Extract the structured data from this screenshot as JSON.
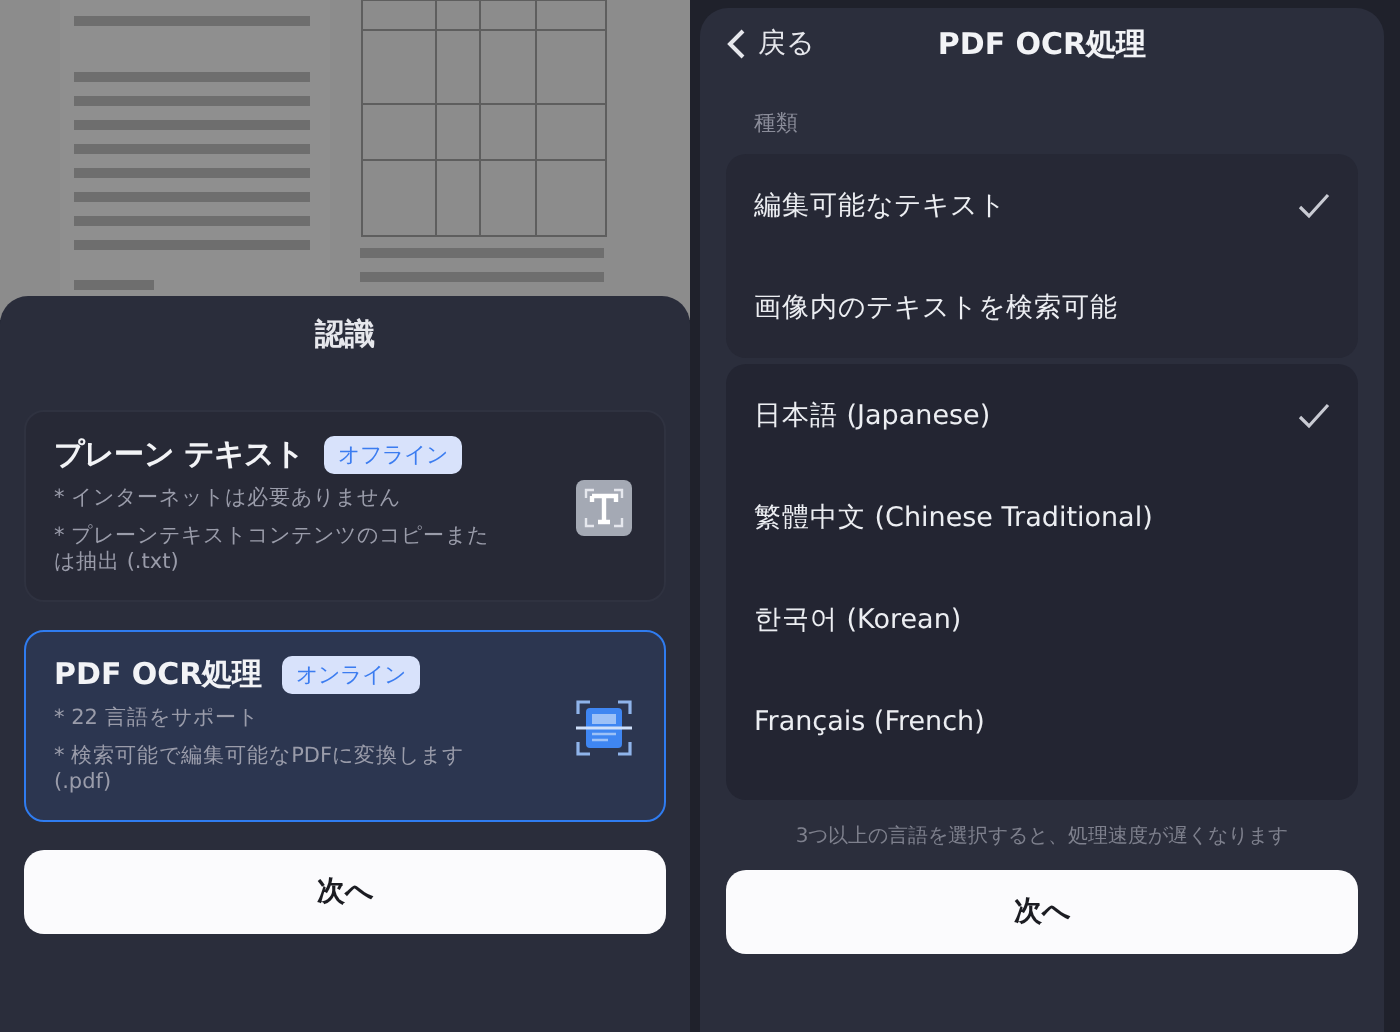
{
  "left_sheet": {
    "title": "認識",
    "modes": [
      {
        "name": "プレーン テキスト",
        "badge": "オフライン",
        "kind": "text",
        "selected": false,
        "notes": [
          "* インターネットは必要ありません",
          "* プレーンテキストコンテンツのコピーまたは抽出 (.txt)"
        ]
      },
      {
        "name": "PDF OCR処理",
        "badge": "オンライン",
        "kind": "scan",
        "selected": true,
        "notes": [
          "* 22 言語をサポート",
          "* 検索可能で編集可能なPDFに変換します (.pdf)"
        ]
      }
    ],
    "next_button": "次へ"
  },
  "right_sheet": {
    "back": "戻る",
    "title": "PDF OCR処理",
    "section_label": "種類",
    "types": [
      {
        "label": "編集可能なテキスト",
        "selected": true
      },
      {
        "label": "画像内のテキストを検索可能",
        "selected": false
      }
    ],
    "languages": [
      {
        "label": "日本語 (Japanese)",
        "checked": true
      },
      {
        "label": "繁體中文 (Chinese Traditional)",
        "checked": false
      },
      {
        "label": "한국어 (Korean)",
        "checked": false
      },
      {
        "label": "Français (French)",
        "checked": false
      }
    ],
    "hint": "3つ以上の言語を選択すると、処理速度が遅くなります",
    "next_button": "次へ"
  }
}
